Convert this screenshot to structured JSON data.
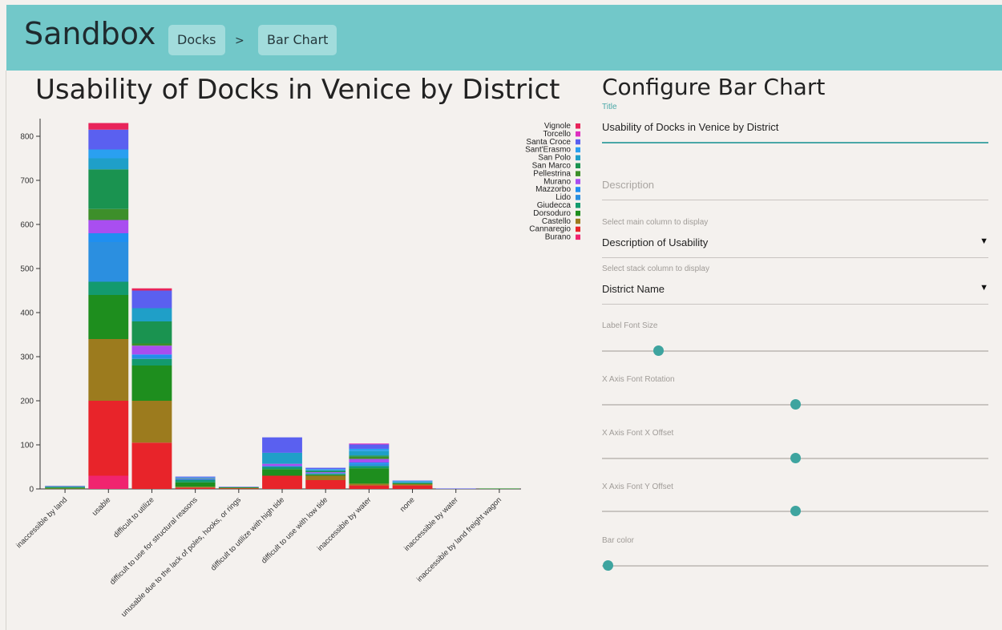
{
  "app": {
    "title": "Sandbox",
    "breadcrumbs": [
      {
        "label": "Docks"
      },
      {
        "label": "Bar Chart"
      }
    ],
    "separator": ">"
  },
  "colors": {
    "header_bg": "#72c8c9",
    "accent": "#3ea49f",
    "background": "#f4f1ee"
  },
  "chart_data": {
    "type": "bar",
    "stacked": true,
    "title": "Usability of Docks in Venice by District",
    "xlabel": "",
    "ylabel": "",
    "ylim": [
      0,
      840
    ],
    "yticks": [
      0,
      100,
      200,
      300,
      400,
      500,
      600,
      700,
      800
    ],
    "categories": [
      "inaccessible by land",
      "usable",
      "difficult to utilize",
      "difficult to use for structural reasons",
      "unusable due to the lack of poles, hooks, or rings",
      "difficult to utilize with high tide",
      "difficult to use with low tide",
      "inaccessible by water",
      "none",
      "inaccessible by water",
      "inaccessible by land freight wagon"
    ],
    "legend_position": "top-right",
    "series": [
      {
        "name": "Burano",
        "color": "#f0246f",
        "values": [
          0,
          30,
          0,
          0,
          0,
          0,
          0,
          0,
          0,
          0,
          0
        ]
      },
      {
        "name": "Cannaregio",
        "color": "#e8242a",
        "values": [
          0,
          170,
          105,
          3,
          1,
          30,
          20,
          8,
          8,
          0,
          0
        ]
      },
      {
        "name": "Castello",
        "color": "#9c7b1e",
        "values": [
          1,
          140,
          95,
          2,
          1,
          0,
          10,
          4,
          3,
          0,
          0
        ]
      },
      {
        "name": "Dorsoduro",
        "color": "#1e8e1e",
        "values": [
          2,
          100,
          80,
          10,
          2,
          15,
          2,
          35,
          2,
          0,
          1
        ]
      },
      {
        "name": "Giudecca",
        "color": "#139a6e",
        "values": [
          1,
          30,
          15,
          5,
          0,
          5,
          2,
          5,
          1,
          0,
          0
        ]
      },
      {
        "name": "Lido",
        "color": "#2b8fe0",
        "values": [
          1,
          90,
          5,
          2,
          0,
          0,
          2,
          5,
          1,
          0,
          0
        ]
      },
      {
        "name": "Mazzorbo",
        "color": "#1f8ff0",
        "values": [
          0,
          20,
          5,
          0,
          0,
          2,
          0,
          3,
          0,
          0,
          0
        ]
      },
      {
        "name": "Murano",
        "color": "#a94ef0",
        "values": [
          0,
          30,
          20,
          1,
          0,
          5,
          2,
          8,
          0,
          0,
          0
        ]
      },
      {
        "name": "Pellestrina",
        "color": "#3d8f2a",
        "values": [
          0,
          25,
          5,
          0,
          0,
          0,
          0,
          5,
          0,
          0,
          0
        ]
      },
      {
        "name": "San Marco",
        "color": "#1a9350",
        "values": [
          1,
          90,
          50,
          1,
          0,
          0,
          3,
          3,
          0,
          0,
          0
        ]
      },
      {
        "name": "San Polo",
        "color": "#1f9fc8",
        "values": [
          0,
          25,
          30,
          1,
          0,
          25,
          2,
          10,
          2,
          0,
          0
        ]
      },
      {
        "name": "Sant'Erasmo",
        "color": "#2aa0f0",
        "values": [
          0,
          20,
          0,
          1,
          0,
          0,
          2,
          5,
          1,
          0,
          0
        ]
      },
      {
        "name": "Santa Croce",
        "color": "#5a60f0",
        "values": [
          1,
          45,
          40,
          2,
          1,
          35,
          3,
          10,
          1,
          1,
          0
        ]
      },
      {
        "name": "Torcello",
        "color": "#de2fc0",
        "values": [
          0,
          0,
          0,
          0,
          0,
          0,
          0,
          2,
          0,
          0,
          0
        ]
      },
      {
        "name": "Vignole",
        "color": "#e8245a",
        "values": [
          0,
          15,
          5,
          0,
          0,
          0,
          0,
          0,
          0,
          0,
          0
        ]
      }
    ]
  },
  "config": {
    "title": "Configure Bar Chart",
    "title_field": {
      "label": "Title",
      "value": "Usability of Docks in Venice by District"
    },
    "description_field": {
      "placeholder": "Description"
    },
    "main_column": {
      "label": "Select main column to display",
      "value": "Description of Usability"
    },
    "stack_column": {
      "label": "Select stack column to display",
      "value": "District Name"
    },
    "caret": "▼",
    "sliders": [
      {
        "label": "Label Font Size",
        "value": 0.145
      },
      {
        "label": "X Axis Font Rotation",
        "value": 0.5
      },
      {
        "label": "X Axis Font X Offset",
        "value": 0.5
      },
      {
        "label": "X Axis Font Y Offset",
        "value": 0.5
      },
      {
        "label": "Bar color",
        "value": 0.015
      }
    ]
  }
}
